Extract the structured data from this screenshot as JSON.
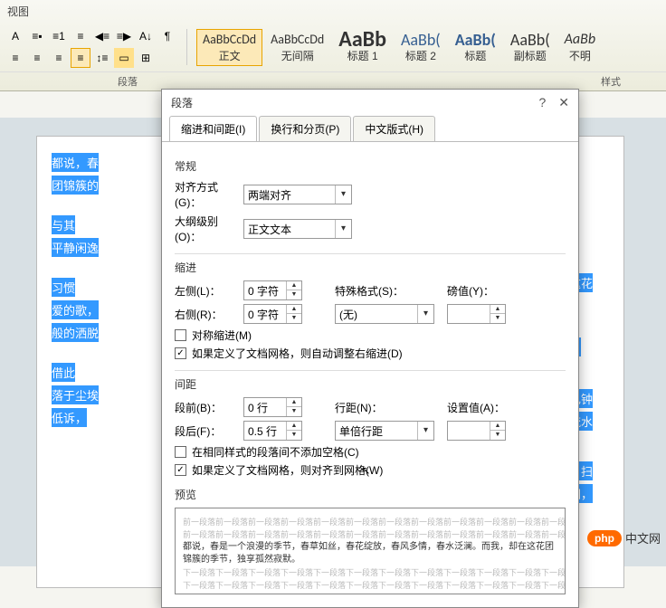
{
  "ribbon": {
    "tab": "视图",
    "paragraph_group": "段落",
    "styles_group": "样式",
    "styles": [
      {
        "sample": "AaBbCcDd",
        "label": "正文",
        "cls": ""
      },
      {
        "sample": "AaBbCcDd",
        "label": "无间隔",
        "cls": ""
      },
      {
        "sample": "AaBb",
        "label": "标题 1",
        "cls": "h1"
      },
      {
        "sample": "AaBb(",
        "label": "标题 2",
        "cls": "h2"
      },
      {
        "sample": "AaBb(",
        "label": "标题",
        "cls": "h3"
      },
      {
        "sample": "AaBb(",
        "label": "副标题",
        "cls": "sub"
      },
      {
        "sample": "AaBb",
        "label": "不明",
        "cls": "no"
      }
    ]
  },
  "dialog": {
    "title": "段落",
    "tabs": [
      "缩进和间距(I)",
      "换行和分页(P)",
      "中文版式(H)"
    ],
    "general": {
      "title": "常规",
      "align_label": "对齐方式(G)：",
      "align_value": "两端对齐",
      "outline_label": "大纲级别(O)：",
      "outline_value": "正文文本"
    },
    "indent": {
      "title": "缩进",
      "left_label": "左侧(L)：",
      "left_value": "0 字符",
      "right_label": "右侧(R)：",
      "right_value": "0 字符",
      "special_label": "特殊格式(S)：",
      "special_value": "(无)",
      "by_label": "磅值(Y)：",
      "chk_sym": "对称缩进(M)",
      "chk_grid": "如果定义了文档网格，则自动调整右缩进(D)"
    },
    "spacing": {
      "title": "间距",
      "before_label": "段前(B)：",
      "before_value": "0 行",
      "after_label": "段后(F)：",
      "after_value": "0.5 行",
      "line_label": "行距(N)：",
      "line_value": "单倍行距",
      "at_label": "设置值(A)：",
      "chk_nospace": "在相同样式的段落间不添加空格(C)",
      "chk_snap": "如果定义了文档网格，则对齐到网格(W)"
    },
    "preview": {
      "title": "预览",
      "before": "前一段落前一段落前一段落前一段落前一段落前一段落前一段落前一段落前一段落前一段落前一段落前一段落前一段落前一段落前一段落前一段落",
      "main": "都说，春是一个浪漫的季节，春草如丝，春花绽放，春风多情，春水泛澜。而我，却在这花团锦簇的季节，独享孤然寂默。",
      "after": "下一段落下一段落下一段落下一段落下一段落下一段落下一段落下一段落下一段落下一段落下一段落下一段落下一段落下一段落下一段落下一段落下一段落下一段落下一段落下一段落下一段落"
    }
  },
  "doc": {
    "lines": [
      "都说，春",
      "在这花",
      "团锦簇的",
      "与其",
      "持，",
      "平静闲逸",
      "习惯",
      "自己钟",
      "爱的歌，",
      "云流水",
      "般的洒脱",
      "借此",
      "邸，扫",
      "落于尘埃",
      "客们，",
      "低诉，"
    ]
  },
  "watermark": {
    "badge": "php",
    "text": "中文网"
  }
}
